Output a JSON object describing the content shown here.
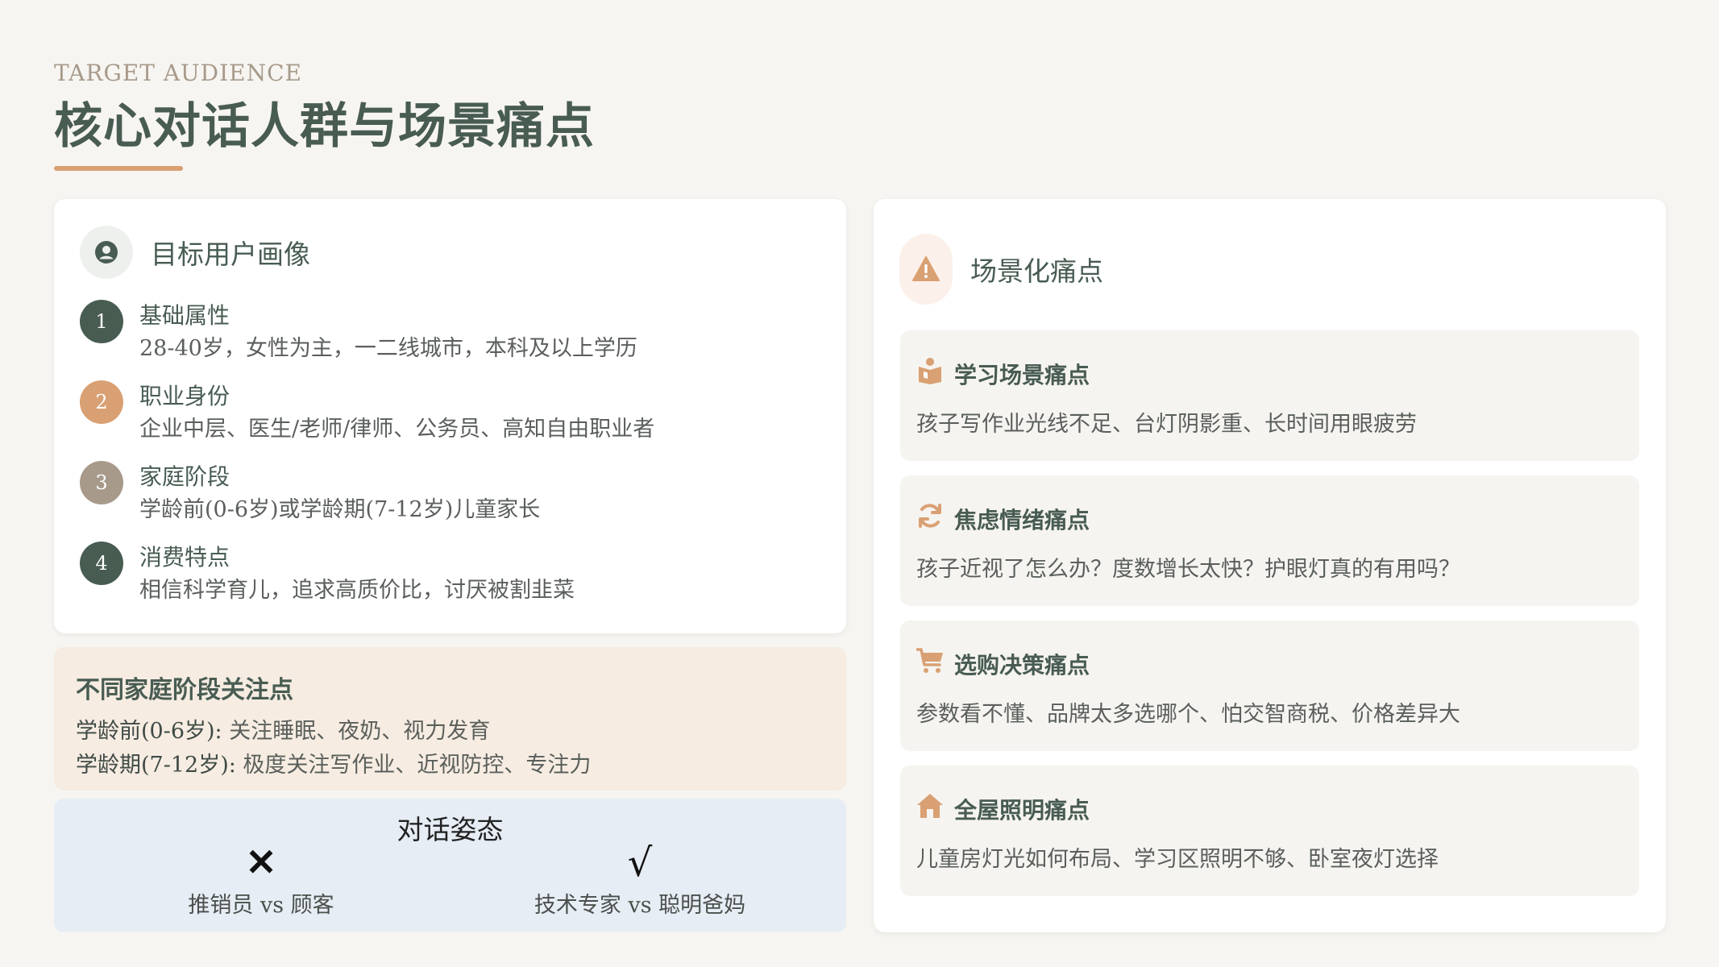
{
  "header": {
    "eyebrow": "TARGET AUDIENCE",
    "title": "核心对话人群与场景痛点"
  },
  "colors": {
    "accent_orange": "#d9a073",
    "dark_green": "#485c52",
    "gray_taupe": "#a79a8b"
  },
  "persona": {
    "heading": "目标用户画像",
    "icon": "user-circle-icon",
    "items": [
      {
        "num": "1",
        "title": "基础属性",
        "desc": "28-40岁，女性为主，一二线城市，本科及以上学历",
        "color": "#485c52"
      },
      {
        "num": "2",
        "title": "职业身份",
        "desc": "企业中层、医生/老师/律师、公务员、高知自由职业者",
        "color": "#d9a073"
      },
      {
        "num": "3",
        "title": "家庭阶段",
        "desc": "学龄前(0-6岁)或学龄期(7-12岁)儿童家长",
        "color": "#a79a8b"
      },
      {
        "num": "4",
        "title": "消费特点",
        "desc": "相信科学育儿，追求高质价比，讨厌被割韭菜",
        "color": "#485c52"
      }
    ]
  },
  "family": {
    "title": "不同家庭阶段关注点",
    "lines": [
      {
        "label": "学龄前(0-6岁):",
        "text": " 关注睡眠、夜奶、视力发育"
      },
      {
        "label": "学龄期(7-12岁):",
        "text": " 极度关注写作业、近视防控、专注力"
      }
    ]
  },
  "stance": {
    "title": "对话姿态",
    "wrong_mark": "✕",
    "wrong_caption": "推销员 vs 顾客",
    "right_mark": "√",
    "right_caption": "技术专家 vs 聪明爸妈"
  },
  "pain_points": {
    "heading": "场景化痛点",
    "icon": "warning-icon",
    "items": [
      {
        "title": "学习场景痛点",
        "desc": "孩子写作业光线不足、台灯阴影重、长时间用眼疲劳",
        "icon": "reader-icon"
      },
      {
        "title": "焦虑情绪痛点",
        "desc": "孩子近视了怎么办？度数增长太快？护眼灯真的有用吗？",
        "icon": "refresh-icon"
      },
      {
        "title": "选购决策痛点",
        "desc": "参数看不懂、品牌太多选哪个、怕交智商税、价格差异大",
        "icon": "cart-icon"
      },
      {
        "title": "全屋照明痛点",
        "desc": "儿童房灯光如何布局、学习区照明不够、卧室夜灯选择",
        "icon": "home-icon"
      }
    ]
  }
}
